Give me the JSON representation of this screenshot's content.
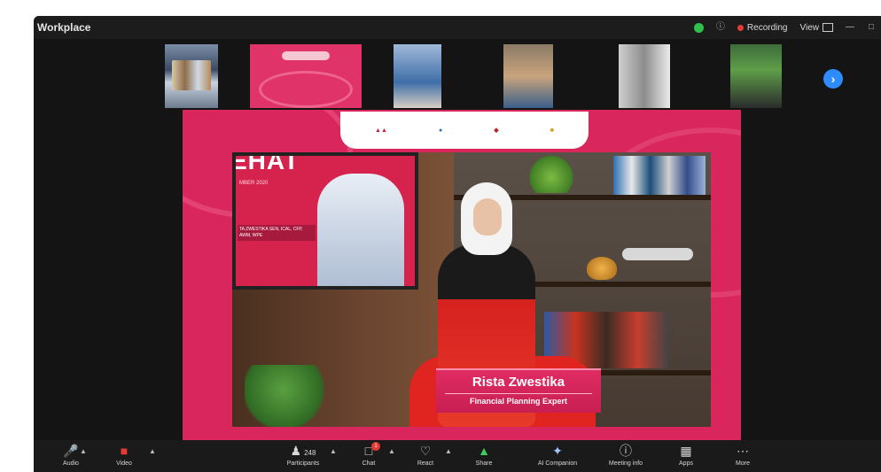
{
  "window": {
    "title": "Workplace"
  },
  "titlebar": {
    "recording_label": "Recording",
    "view_label": "View"
  },
  "participants_strip": {
    "next_icon": "chevron-right-icon"
  },
  "presentation": {
    "logos": [
      "",
      "",
      "",
      ""
    ],
    "screen_title": "EHAT",
    "screen_date": "MBER 2020",
    "screen_caption": "TA ZWESTIKA SEN, ICAL, CFP, AWM, WPE"
  },
  "lower_third": {
    "name": "Rista Zwestika",
    "role": "Financial Planning Expert"
  },
  "toolbar": {
    "audio_label": "Audio",
    "video_label": "Video",
    "participants_label": "Participants",
    "participants_count": "248",
    "chat_label": "Chat",
    "chat_badge": "1",
    "react_label": "React",
    "share_label": "Share",
    "ai_label": "AI Companion",
    "meeting_info_label": "Meeting info",
    "apps_label": "Apps",
    "more_label": "More"
  },
  "colors": {
    "accent_pink": "#d9275e",
    "record_red": "#e53935",
    "next_blue": "#2d8cff"
  }
}
